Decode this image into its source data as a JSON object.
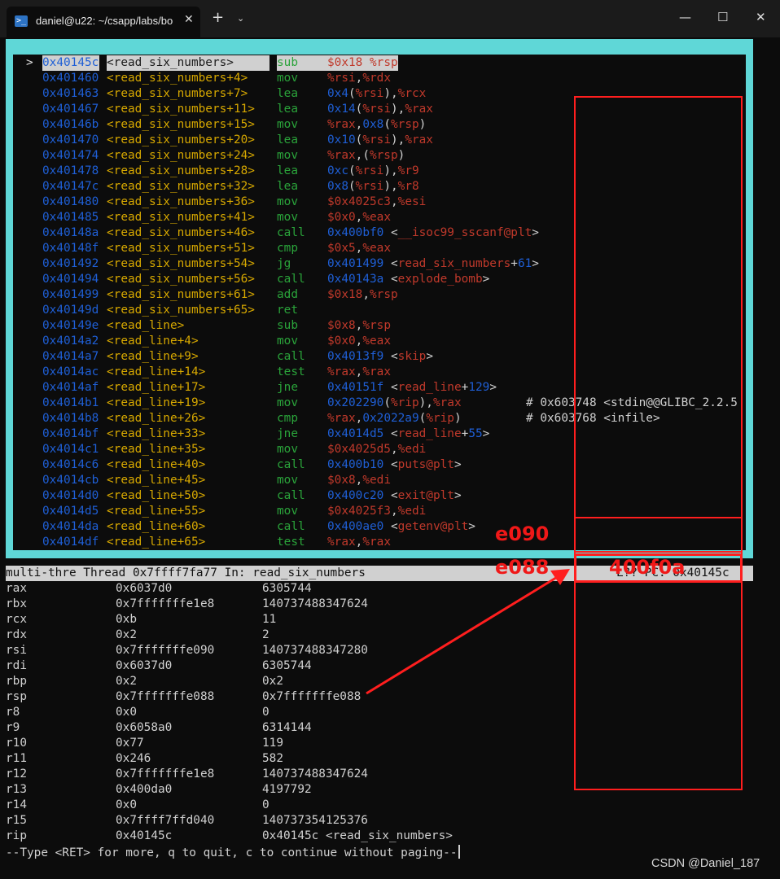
{
  "window": {
    "tab_title": "daniel@u22: ~/csapp/labs/bo",
    "new_tab_symbol": "+",
    "dropdown_symbol": "⌄",
    "tab_close_symbol": "✕",
    "minimize_symbol": "—",
    "maximize_symbol": "☐",
    "close_symbol": "✕",
    "tab_icon": "terminal-icon"
  },
  "disassembly": [
    {
      "marker": ">",
      "addr": "0x40145c",
      "sym": "<read_six_numbers>",
      "op": "sub",
      "args": "$0x18,%rsp",
      "current": true
    },
    {
      "marker": "",
      "addr": "0x401460",
      "sym": "<read_six_numbers+4>",
      "op": "mov",
      "args": "%rsi,%rdx"
    },
    {
      "marker": "",
      "addr": "0x401463",
      "sym": "<read_six_numbers+7>",
      "op": "lea",
      "args": "0x4(%rsi),%rcx"
    },
    {
      "marker": "",
      "addr": "0x401467",
      "sym": "<read_six_numbers+11>",
      "op": "lea",
      "args": "0x14(%rsi),%rax"
    },
    {
      "marker": "",
      "addr": "0x40146b",
      "sym": "<read_six_numbers+15>",
      "op": "mov",
      "args": "%rax,0x8(%rsp)"
    },
    {
      "marker": "",
      "addr": "0x401470",
      "sym": "<read_six_numbers+20>",
      "op": "lea",
      "args": "0x10(%rsi),%rax"
    },
    {
      "marker": "",
      "addr": "0x401474",
      "sym": "<read_six_numbers+24>",
      "op": "mov",
      "args": "%rax,(%rsp)"
    },
    {
      "marker": "",
      "addr": "0x401478",
      "sym": "<read_six_numbers+28>",
      "op": "lea",
      "args": "0xc(%rsi),%r9"
    },
    {
      "marker": "",
      "addr": "0x40147c",
      "sym": "<read_six_numbers+32>",
      "op": "lea",
      "args": "0x8(%rsi),%r8"
    },
    {
      "marker": "",
      "addr": "0x401480",
      "sym": "<read_six_numbers+36>",
      "op": "mov",
      "args": "$0x4025c3,%esi"
    },
    {
      "marker": "",
      "addr": "0x401485",
      "sym": "<read_six_numbers+41>",
      "op": "mov",
      "args": "$0x0,%eax"
    },
    {
      "marker": "",
      "addr": "0x40148a",
      "sym": "<read_six_numbers+46>",
      "op": "call",
      "args": "0x400bf0 <__isoc99_sscanf@plt>"
    },
    {
      "marker": "",
      "addr": "0x40148f",
      "sym": "<read_six_numbers+51>",
      "op": "cmp",
      "args": "$0x5,%eax"
    },
    {
      "marker": "",
      "addr": "0x401492",
      "sym": "<read_six_numbers+54>",
      "op": "jg",
      "args": "0x401499 <read_six_numbers+61>"
    },
    {
      "marker": "",
      "addr": "0x401494",
      "sym": "<read_six_numbers+56>",
      "op": "call",
      "args": "0x40143a <explode_bomb>"
    },
    {
      "marker": "",
      "addr": "0x401499",
      "sym": "<read_six_numbers+61>",
      "op": "add",
      "args": "$0x18,%rsp"
    },
    {
      "marker": "",
      "addr": "0x40149d",
      "sym": "<read_six_numbers+65>",
      "op": "ret",
      "args": ""
    },
    {
      "marker": "",
      "addr": "0x40149e",
      "sym": "<read_line>",
      "op": "sub",
      "args": "$0x8,%rsp"
    },
    {
      "marker": "",
      "addr": "0x4014a2",
      "sym": "<read_line+4>",
      "op": "mov",
      "args": "$0x0,%eax"
    },
    {
      "marker": "",
      "addr": "0x4014a7",
      "sym": "<read_line+9>",
      "op": "call",
      "args": "0x4013f9 <skip>"
    },
    {
      "marker": "",
      "addr": "0x4014ac",
      "sym": "<read_line+14>",
      "op": "test",
      "args": "%rax,%rax"
    },
    {
      "marker": "",
      "addr": "0x4014af",
      "sym": "<read_line+17>",
      "op": "jne",
      "args": "0x40151f <read_line+129>"
    },
    {
      "marker": "",
      "addr": "0x4014b1",
      "sym": "<read_line+19>",
      "op": "mov",
      "args": "0x202290(%rip),%rax",
      "comment": "# 0x603748 <stdin@@GLIBC_2.2.5"
    },
    {
      "marker": "",
      "addr": "0x4014b8",
      "sym": "<read_line+26>",
      "op": "cmp",
      "args": "%rax,0x2022a9(%rip)",
      "comment": "# 0x603768 <infile>"
    },
    {
      "marker": "",
      "addr": "0x4014bf",
      "sym": "<read_line+33>",
      "op": "jne",
      "args": "0x4014d5 <read_line+55>"
    },
    {
      "marker": "",
      "addr": "0x4014c1",
      "sym": "<read_line+35>",
      "op": "mov",
      "args": "$0x4025d5,%edi"
    },
    {
      "marker": "",
      "addr": "0x4014c6",
      "sym": "<read_line+40>",
      "op": "call",
      "args": "0x400b10 <puts@plt>"
    },
    {
      "marker": "",
      "addr": "0x4014cb",
      "sym": "<read_line+45>",
      "op": "mov",
      "args": "$0x8,%edi"
    },
    {
      "marker": "",
      "addr": "0x4014d0",
      "sym": "<read_line+50>",
      "op": "call",
      "args": "0x400c20 <exit@plt>"
    },
    {
      "marker": "",
      "addr": "0x4014d5",
      "sym": "<read_line+55>",
      "op": "mov",
      "args": "$0x4025f3,%edi"
    },
    {
      "marker": "",
      "addr": "0x4014da",
      "sym": "<read_line+60>",
      "op": "call",
      "args": "0x400ae0 <getenv@plt>"
    },
    {
      "marker": "",
      "addr": "0x4014df",
      "sym": "<read_line+65>",
      "op": "test",
      "args": "%rax,%rax"
    }
  ],
  "status_bar": {
    "left": "multi-thre Thread 0x7ffff7fa77 In: read_six_numbers",
    "right": "L?? PC: 0x40145c"
  },
  "registers": [
    {
      "name": "rax",
      "hex": "0x6037d0",
      "val": "6305744"
    },
    {
      "name": "rbx",
      "hex": "0x7fffffffe1e8",
      "val": "140737488347624"
    },
    {
      "name": "rcx",
      "hex": "0xb",
      "val": "11"
    },
    {
      "name": "rdx",
      "hex": "0x2",
      "val": "2"
    },
    {
      "name": "rsi",
      "hex": "0x7fffffffe090",
      "val": "140737488347280"
    },
    {
      "name": "rdi",
      "hex": "0x6037d0",
      "val": "6305744"
    },
    {
      "name": "rbp",
      "hex": "0x2",
      "val": "0x2"
    },
    {
      "name": "rsp",
      "hex": "0x7fffffffe088",
      "val": "0x7fffffffe088"
    },
    {
      "name": "r8",
      "hex": "0x0",
      "val": "0"
    },
    {
      "name": "r9",
      "hex": "0x6058a0",
      "val": "6314144"
    },
    {
      "name": "r10",
      "hex": "0x77",
      "val": "119"
    },
    {
      "name": "r11",
      "hex": "0x246",
      "val": "582"
    },
    {
      "name": "r12",
      "hex": "0x7fffffffe1e8",
      "val": "140737488347624"
    },
    {
      "name": "r13",
      "hex": "0x400da0",
      "val": "4197792"
    },
    {
      "name": "r14",
      "hex": "0x0",
      "val": "0"
    },
    {
      "name": "r15",
      "hex": "0x7ffff7ffd040",
      "val": "140737354125376"
    },
    {
      "name": "rip",
      "hex": "0x40145c",
      "val": "0x40145c <read_six_numbers>"
    }
  ],
  "pager_prompt": "--Type <RET> for more, q to quit, c to continue without paging--",
  "annotations": {
    "label_e090": "e090",
    "label_e088": "e088",
    "stack_value": "400f0a",
    "color": "#ff1e1e"
  },
  "watermark": "CSDN @Daniel_187"
}
